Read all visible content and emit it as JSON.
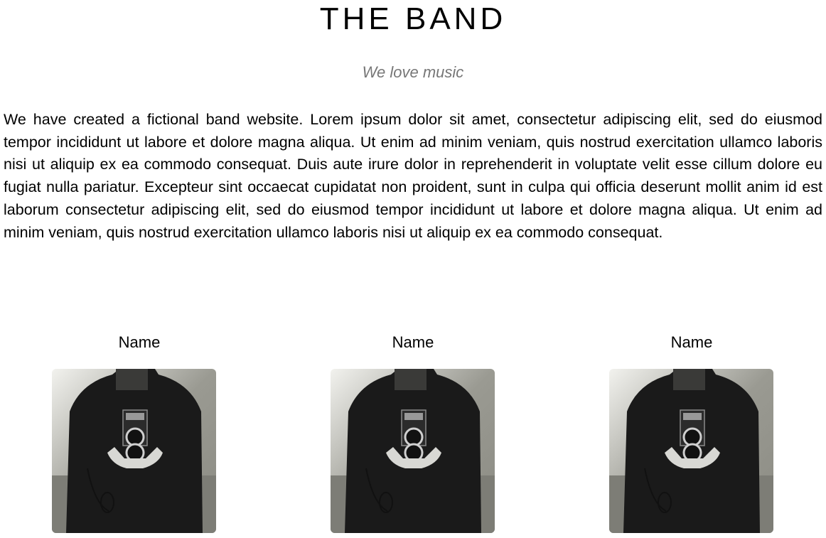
{
  "header": {
    "title": "THE BAND",
    "tagline": "We love music"
  },
  "intro": {
    "text": "We have created a fictional band website. Lorem ipsum dolor sit amet, consectetur adipiscing elit, sed do eiusmod tempor incididunt ut labore et dolore magna aliqua. Ut enim ad minim veniam, quis nostrud exercitation ullamco laboris nisi ut aliquip ex ea commodo consequat. Duis aute irure dolor in reprehenderit in voluptate velit esse cillum dolore eu fugiat nulla pariatur. Excepteur sint occaecat cupidatat non proident, sunt in culpa qui officia deserunt mollit anim id est laborum consectetur adipiscing elit, sed do eiusmod tempor incididunt ut labore et dolore magna aliqua. Ut enim ad minim veniam, quis nostrud exercitation ullamco laboris nisi ut aliquip ex ea commodo consequat."
  },
  "members": [
    {
      "name": "Name",
      "photo": "man-with-camera-photo"
    },
    {
      "name": "Name",
      "photo": "man-with-camera-photo"
    },
    {
      "name": "Name",
      "photo": "man-with-camera-photo"
    }
  ]
}
